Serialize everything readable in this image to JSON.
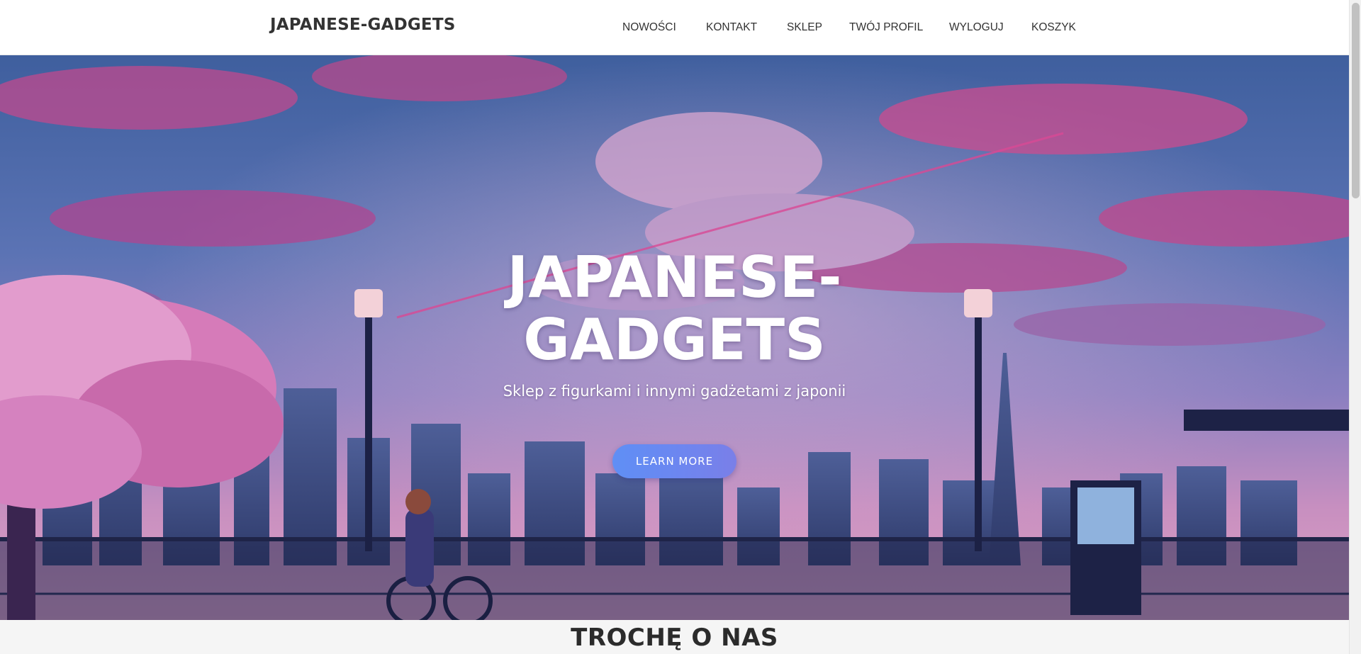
{
  "navbar": {
    "brand": "JAPANESE-GADGETS",
    "items": [
      {
        "label": "NOWOŚCI"
      },
      {
        "label": "KONTAKT"
      },
      {
        "label": "SKLEP"
      },
      {
        "label": "TWÓJ PROFIL"
      },
      {
        "label": "WYLOGUJ"
      },
      {
        "label": "KOSZYK"
      }
    ]
  },
  "hero": {
    "title_line1": "JAPANESE-",
    "title_line2": "GADGETS",
    "subtitle": "Sklep z figurkami i innymi gadżetami z japonii",
    "button_label": "LEARN MORE",
    "background": "anime-city-sunset-illustration"
  },
  "about": {
    "title": "TROCHĘ O NAS"
  },
  "colors": {
    "navbar_bg": "#ffffff",
    "text_dark": "#333333",
    "button_gradient_start": "#5f8ff5",
    "button_gradient_end": "#7a7fe8",
    "page_bg": "#f5f5f5"
  }
}
